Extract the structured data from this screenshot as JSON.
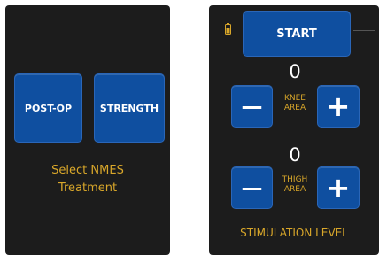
{
  "treatment_panel": {
    "post_op_label": "POST-OP",
    "strength_label": "STRENGTH",
    "prompt_line1": "Select NMES",
    "prompt_line2": "Treatment"
  },
  "stim_panel": {
    "start_label": "START",
    "knee": {
      "value": "0",
      "label_line1": "KNEE",
      "label_line2": "AREA",
      "minus_symbol": "—",
      "plus_symbol": "+"
    },
    "thigh": {
      "value": "0",
      "label_line1": "THIGH",
      "label_line2": "AREA",
      "minus_symbol": "—",
      "plus_symbol": "+"
    },
    "footer": "STIMULATION LEVEL"
  },
  "colors": {
    "panel_bg": "#1c1c1c",
    "button_blue": "#0f4fa0",
    "label_yellow": "#d9a72a",
    "text_white": "#ffffff"
  },
  "icons": {
    "battery": "battery-icon"
  }
}
